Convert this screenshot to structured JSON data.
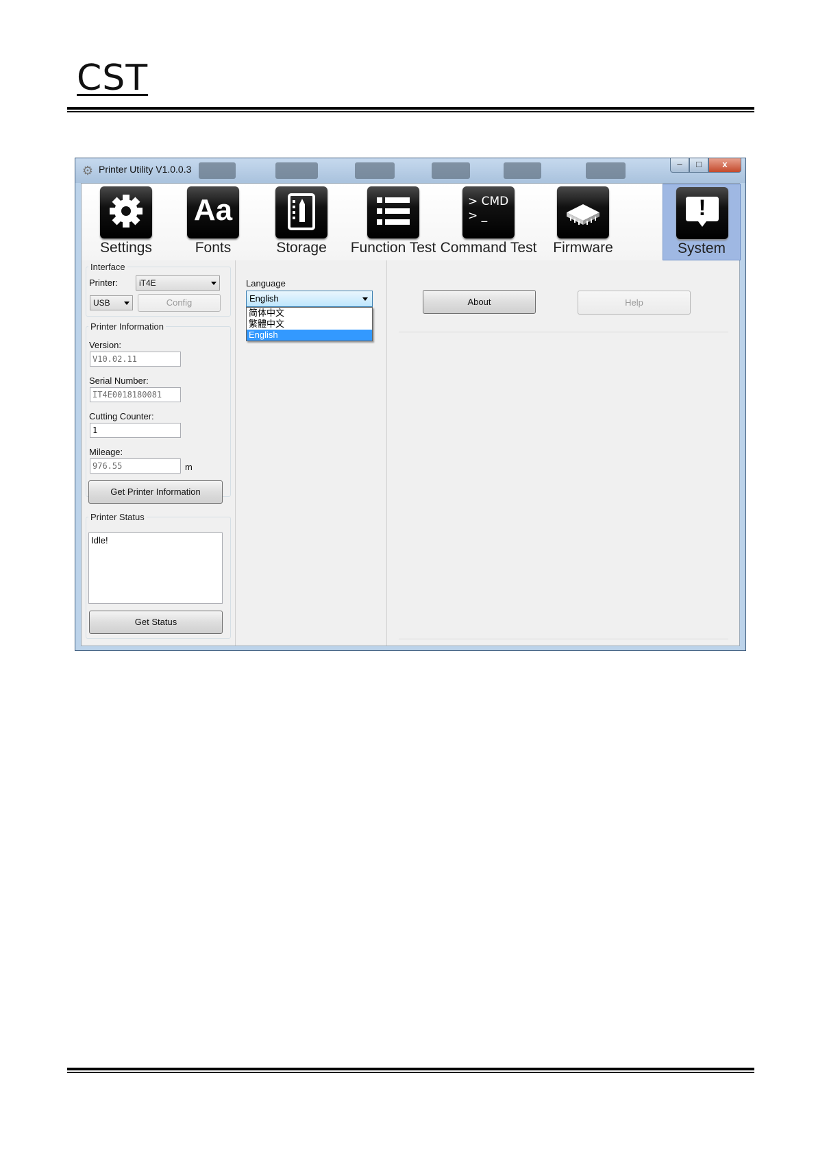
{
  "document": {
    "logo_text": "CST"
  },
  "window": {
    "title": "Printer Utility  V1.0.0.3",
    "controls": {
      "minimize": "–",
      "maximize": "□",
      "close": "x"
    }
  },
  "toolbar": {
    "items": [
      {
        "label": "Settings",
        "icon": "gear-icon"
      },
      {
        "label": "Fonts",
        "icon": "font-aa-icon",
        "glyph": "Aa"
      },
      {
        "label": "Storage",
        "icon": "storage-drive-icon"
      },
      {
        "label": "Function Test",
        "icon": "list-icon"
      },
      {
        "label": "Command Test",
        "icon": "command-prompt-icon",
        "glyph_line1": "> CMD",
        "glyph_line2": "> _"
      },
      {
        "label": "Firmware",
        "icon": "chip-icon"
      },
      {
        "label": "System",
        "icon": "exclamation-icon",
        "glyph": "!",
        "active": true
      }
    ],
    "active_color": "#9fb8e3"
  },
  "interface": {
    "legend": "Interface",
    "printer_label": "Printer:",
    "printer_value": "iT4E",
    "port_value": "USB",
    "config_button": "Config"
  },
  "printer_info": {
    "legend": "Printer Information",
    "version_label": "Version:",
    "version_value": "V10.02.11",
    "serial_label": "Serial Number:",
    "serial_value": "IT4E0018180081",
    "cutting_label": "Cutting Counter:",
    "cutting_value": "1",
    "mileage_label": "Mileage:",
    "mileage_value": "976.55",
    "mileage_unit": "m",
    "get_info_button": "Get Printer Information"
  },
  "printer_status": {
    "legend": "Printer Status",
    "status_text": "Idle!",
    "get_status_button": "Get Status"
  },
  "language": {
    "label": "Language",
    "selected": "English",
    "options": [
      "简体中文",
      "繁體中文",
      "English"
    ],
    "highlight_color": "#3399ff"
  },
  "system": {
    "about_button": "About",
    "help_button": "Help"
  }
}
